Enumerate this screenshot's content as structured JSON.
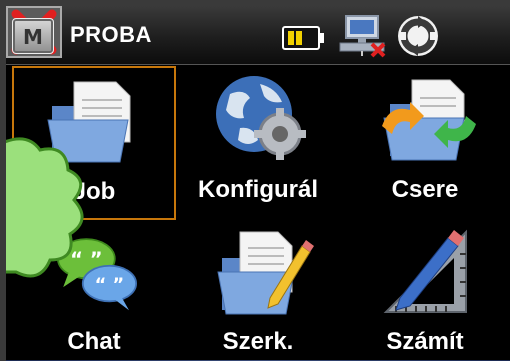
{
  "titlebar": {
    "logo_letter": "M",
    "title": "PROBA"
  },
  "icons": {
    "battery": "battery-half-icon",
    "network": "network-disconnected-icon",
    "sync": "sync-icon",
    "close": "close-icon"
  },
  "tiles": [
    {
      "label": "Job",
      "icon": "folder-document-icon",
      "selected": true
    },
    {
      "label": "Konfigurál",
      "icon": "globe-gear-icon",
      "selected": false
    },
    {
      "label": "Csere",
      "icon": "exchange-documents-icon",
      "selected": false
    },
    {
      "label": "Chat",
      "icon": "chat-bubbles-icon",
      "selected": false
    },
    {
      "label": "Szerk.",
      "icon": "edit-document-icon",
      "selected": false
    },
    {
      "label": "Számít",
      "icon": "calculator-ruler-icon",
      "selected": false
    }
  ],
  "colors": {
    "selection_border": "#c7770b",
    "close_red": "#e02020",
    "battery_yellow": "#f0d000",
    "annotation_cloud": "#9be07c"
  }
}
